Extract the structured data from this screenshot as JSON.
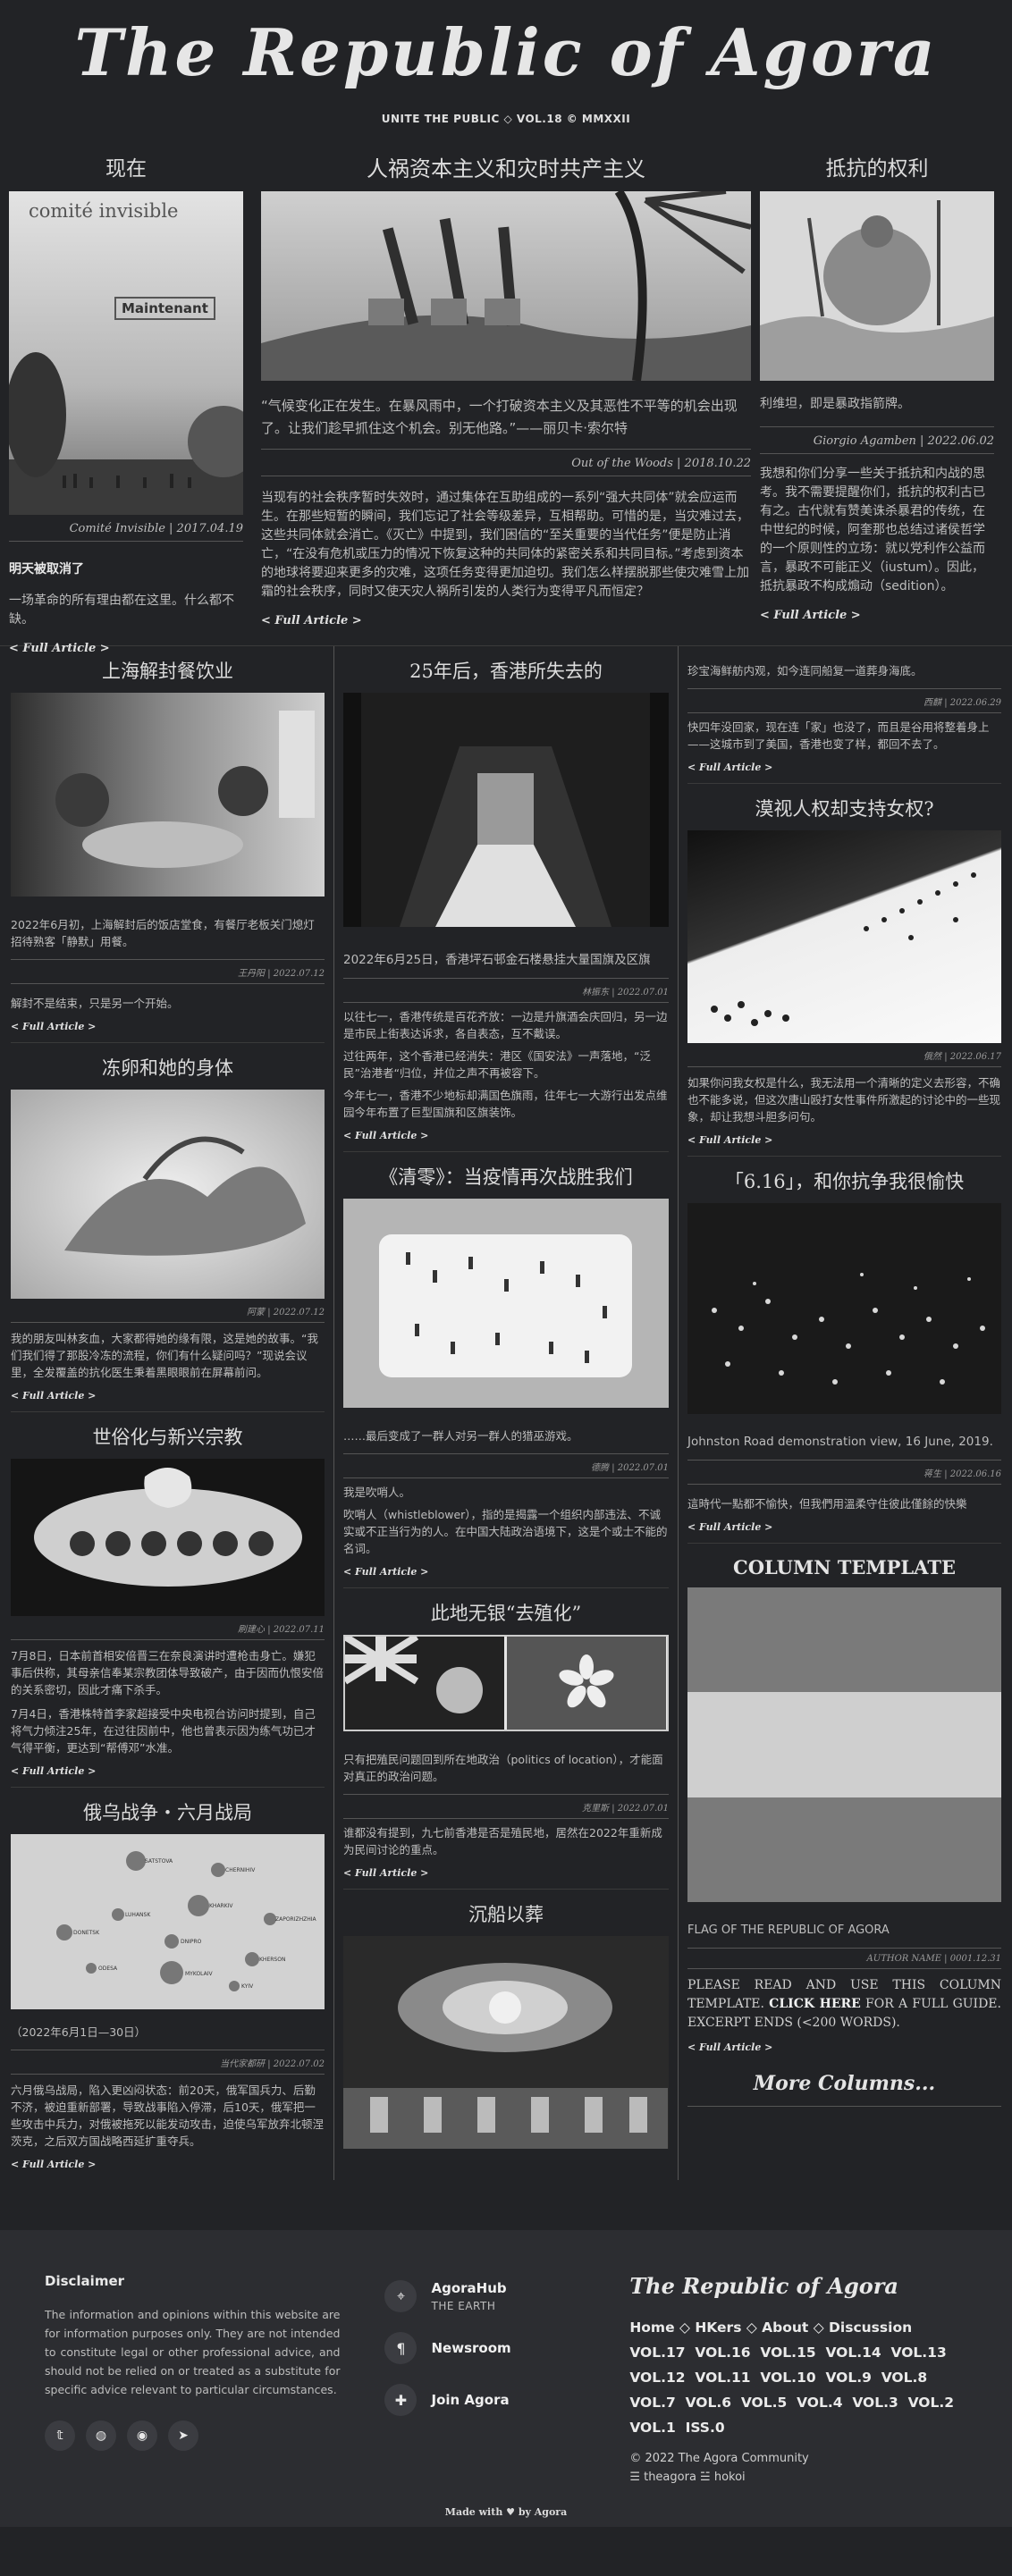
{
  "masthead": {
    "title": "The Republic of Agora",
    "subtitle": "UNITE THE PUBLIC ◇ VOL.18 © MMXXII"
  },
  "top": {
    "left": {
      "title": "现在",
      "img_text1": "comité invisible",
      "img_text2": "Maintenant",
      "caption": "Comité Invisible | 2017.04.19",
      "headline": "明天被取消了",
      "body": "一场革命的所有理由都在这里。什么都不缺。",
      "full": "< Full Article >"
    },
    "mid": {
      "title": "人祸资本主义和灾时共产主义",
      "quote": "“气候变化正在发生。在暴风雨中，一个打破资本主义及其恶性不平等的机会出现了。让我们趁早抓住这个机会。别无他路。”——丽贝卡·索尔特",
      "caption": "Out of the Woods | 2018.10.22",
      "body": "当现有的社会秩序暂时失效时，通过集体在互助组成的一系列“强大共同体”就会应运而生。在那些短暂的瞬间，我们忘记了社会等级差异，互相帮助。可惜的是，当灾难过去，这些共同体就会消亡。《灭亡》中提到，我们困信的“至关重要的当代任务”便是防止消亡，“在没有危机或压力的情况下恢复这种的共同体的紧密关系和共同目标。”考虑到资本的地球将要迎来更多的灾难，这项任务变得更加迫切。我们怎么样摆脱那些使灾难雪上加霜的社会秩序，同时又使天灾人祸所引发的人类行为变得平凡而恒定？",
      "full": "< Full Article >"
    },
    "right": {
      "title": "抵抗的权利",
      "lead": "利维坦，即是暴政指箭牌。",
      "caption": "Giorgio Agamben | 2022.06.02",
      "body": "我想和你们分享一些关于抵抗和内战的思考。我不需要提醒你们，抵抗的权利古已有之。古代就有赞美诛杀暴君的传统，在中世纪的时候，阿奎那也总结过诸侯哲学的一个原则性的立场：就以党利作公益而言，暴政不可能正义（iustum）。因此，抵抗暴政不构成煽动（sedition）。",
      "full": "< Full Article >"
    }
  },
  "lower": {
    "c1": [
      {
        "title": "上海解封餐饮业",
        "body": "2022年6月初，上海解封后的饭店堂食，有餐厅老板关门熄灯招待熟客「静默」用餐。",
        "caption": "王丹阳 | 2022.07.12",
        "body2": "解封不是结束，只是另一个开始。",
        "full": "< Full Article >"
      },
      {
        "title": "冻卵和她的身体",
        "caption": "阿蒙 | 2022.07.12",
        "body": "我的朋友叫林亥血，大家都得她的缘有限，这是她的故事。“我们我们得了那股冷冻的流程，你们有什么疑问吗？”现说会议里，全发覆盖的抗化医生秉着黑眼眼前在屏幕前问。",
        "full": "< Full Article >"
      },
      {
        "title": "世俗化与新兴宗教",
        "caption": "刷建心 | 2022.07.11",
        "body": "7月8日，日本前首相安倍晋三在奈良演讲时遭枪击身亡。嫌犯事后供称，其母亲信奉某宗教团体导致破产，由于因而仇恨安倍的关系密切，因此才痛下杀手。",
        "body2": "7月4日，香港株特首李家超接受中央电视台访问时提到，自己将气力倾注25年，在过往因前中，他也曾表示因为练气功已才气得平衡，更达到“帮傅邓”水准。",
        "full": "< Full Article >"
      },
      {
        "title": "俄乌战争・六月战局",
        "date": "（2022年6月1日—30日）",
        "caption": "当代家都研 | 2022.07.02",
        "body": "六月俄乌战局，陷入更凶闷状态：前20天，俄军国兵力、后勤不济，被迫重新部署，导致战事陷入停滞，后10天，俄军把一些攻击中兵力，对俄被拖死以能发动攻击，迫使乌军放弃北顿涅茨克，之后双方国战略西延扩重夺兵。",
        "full": "< Full Article >"
      }
    ],
    "c2": [
      {
        "title": "25年后，香港所失去的",
        "lead": "2022年6月25日，香港坪石邨金石楼悬挂大量国旗及区旗",
        "caption": "林振东 | 2022.07.01",
        "body": "以往七一，香港传统是百花齐放：一边是升旗酒会庆回归，另一边是市民上街表达诉求，各自表态，互不戴误。",
        "body2": "过往两年，这个香港已经消失：港区《国安法》一声落地，“泛民”治港者“归位，并位之声不再被容下。",
        "body3": "今年七一，香港不少地标却满国色旗雨，往年七一大游行出发点维园今年布置了巨型国旗和区旗装饰。",
        "full": "< Full Article >"
      },
      {
        "title": "《清零》：当疫情再次战胜我们",
        "lead": "……最后变成了一群人对另一群人的猎巫游戏。",
        "caption": "德腾 | 2022.07.01",
        "body": "我是吹哨人。",
        "body2": "吹哨人（whistleblower），指的是揭露一个组织内部违法、不诚实或不正当行为的人。在中国大陆政治语境下，这是个或士不能的名词。",
        "full": "< Full Article >"
      },
      {
        "title": "此地无银“去殖化”",
        "lead": "只有把殖民问题回到所在地政治（politics of location），才能面对真正的政治问题。",
        "caption": "克里斯 | 2022.07.01",
        "body": "谁都没有提到，九七前香港是否是殖民地，居然在2022年重新成为民间讨论的重点。",
        "full": "< Full Article >"
      },
      {
        "title": "沉船以葬"
      }
    ],
    "c3": [
      {
        "lead": "珍宝海鲜舫内观，如今连同船复一道葬身海底。",
        "caption": "西麒 | 2022.06.29",
        "body": "快四年没回家，现在连「家」也没了，而且是谷用将整着身上——这城市到了美国，香港也变了样，都回不去了。",
        "full": "< Full Article >"
      },
      {
        "title": "漠视人权却支持女权?",
        "caption": "俄然 | 2022.06.17",
        "body": "如果你问我女权是什么，我无法用一个清晰的定义去形容，不确也不能多说，但这次唐山殴打女性事件所激起的讨论中的一些现象，却让我想斗胆多问句。",
        "full": "< Full Article >"
      },
      {
        "title": "「6.16」，和你抗争我很愉快",
        "lead": "Johnston Road demonstration view, 16 June, 2019.",
        "caption": "蒋生 | 2022.06.16",
        "body": "這時代一點都不愉快，但我們用溫柔守住彼此僅餘的快樂",
        "full": "< Full Article >"
      },
      {
        "title": "COLUMN TEMPLATE",
        "lead": "FLAG OF THE REPUBLIC OF AGORA",
        "caption": "AUTHOR NAME | 0001.12.31",
        "body_pre": "PLEASE READ AND USE THIS COLUMN TEMPLATE. ",
        "body_link": "CLICK HERE",
        "body_post": " FOR A FULL GUIDE. EXCERPT ENDS (<200 WORDS).",
        "full": "< Full Article >",
        "more": "More Columns..."
      }
    ]
  },
  "chart_labels": [
    "SATSTOVA",
    "CHERNIHIV",
    "KHARKIV",
    "LUHANSK",
    "DONETSK",
    "DNIPRO",
    "ZAPORIZHZHIA",
    "KHERSON",
    "MYKOLAIV",
    "ODESA",
    "KYIV"
  ],
  "footer": {
    "disclaimer_title": "Disclaimer",
    "disclaimer": "The information and opinions within this website are for information purposes only. They are not intended to constitute legal or other professional advice, and should not be relied on or treated as a substitute for specific advice relevant to particular circumstances.",
    "social": [
      "twitter-icon",
      "github-icon",
      "reddit-icon",
      "telegram-icon"
    ],
    "links": [
      {
        "title": "AgoraHub",
        "sub": "THE EARTH",
        "icon": "⌖"
      },
      {
        "title": "Newsroom",
        "sub": "",
        "icon": "¶"
      },
      {
        "title": "Join Agora",
        "sub": "",
        "icon": "✚"
      }
    ],
    "brand": "The Republic of Agora",
    "nav": [
      "Home",
      "HKers",
      "About",
      "Discussion"
    ],
    "vols": [
      "VOL.17",
      "VOL.16",
      "VOL.15",
      "VOL.14",
      "VOL.13",
      "VOL.12",
      "VOL.11",
      "VOL.10",
      "VOL.9",
      "VOL.8",
      "VOL.7",
      "VOL.6",
      "VOL.5",
      "VOL.4",
      "VOL.3",
      "VOL.2",
      "VOL.1",
      "ISS.0"
    ],
    "copyright": "© 2022 The Agora Community",
    "credit": "☰ theagora ☱ hokoi",
    "made": "Made with ♥ by Agora"
  }
}
